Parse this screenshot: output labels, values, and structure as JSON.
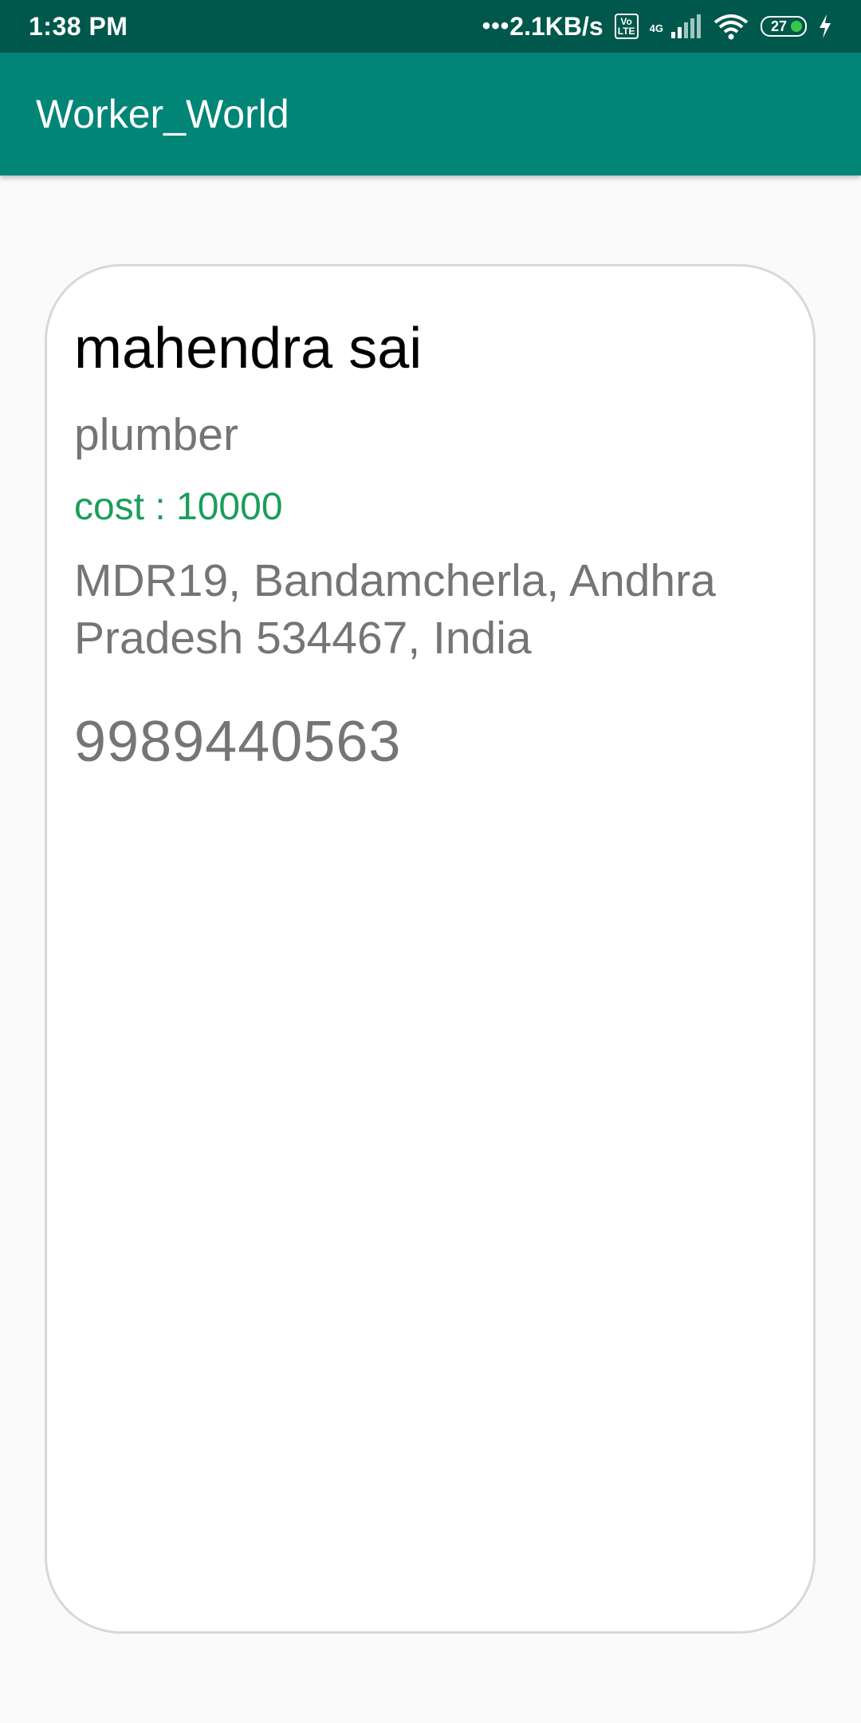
{
  "status_bar": {
    "time": "1:38 PM",
    "dots": "•••",
    "net_speed": "2.1KB/s",
    "volte_label": "Vo\nLTE",
    "network_type": "4G",
    "battery_level": "27",
    "icons": [
      "volte-icon",
      "signal-icon",
      "wifi-icon",
      "battery-icon",
      "charging-bolt-icon"
    ]
  },
  "app_bar": {
    "title": "Worker_World"
  },
  "worker": {
    "name": "mahendra sai",
    "profession": "plumber",
    "cost": "cost : 10000",
    "address": "MDR19, Bandamcherla, Andhra Pradesh 534467, India",
    "phone": "9989440563"
  },
  "colors": {
    "status_bar": "#00574b",
    "app_bar": "#008577",
    "cost_text": "#1a9e5a",
    "secondary_text": "#757575",
    "battery_indicator": "#39c94a"
  }
}
